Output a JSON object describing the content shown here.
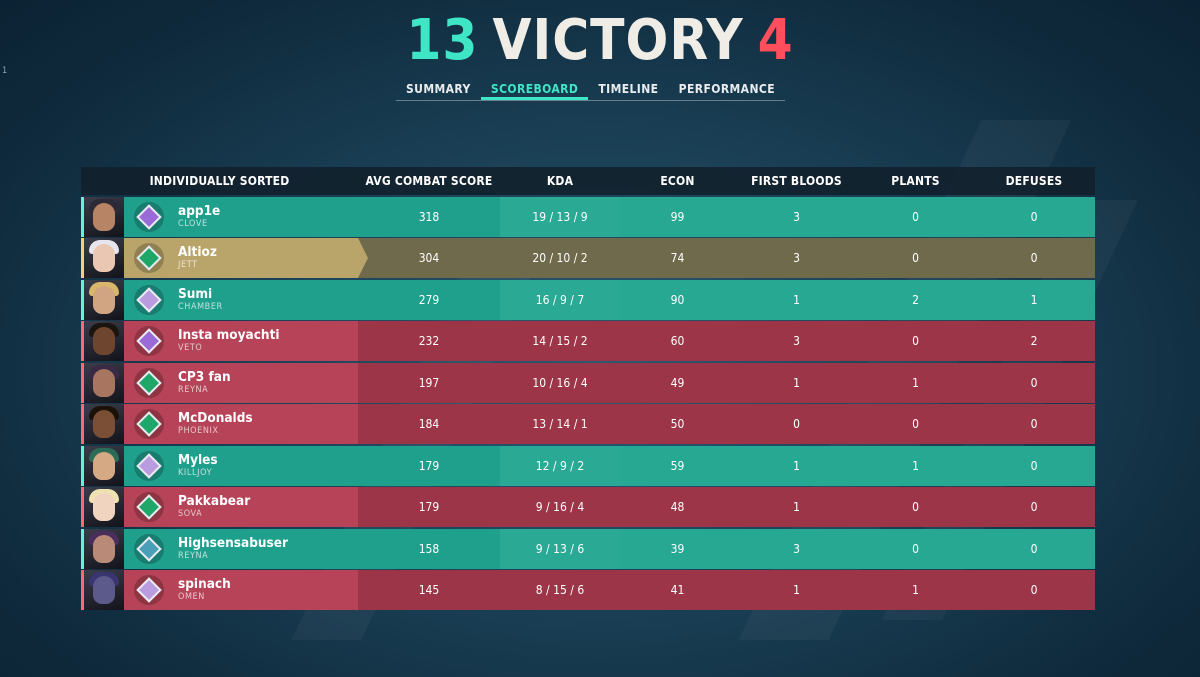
{
  "header": {
    "team_score": "13",
    "result": "VICTORY",
    "enemy_score": "4"
  },
  "corner_mark": "1",
  "tabs": [
    {
      "label": "SUMMARY",
      "active": false
    },
    {
      "label": "SCOREBOARD",
      "active": true
    },
    {
      "label": "TIMELINE",
      "active": false
    },
    {
      "label": "PERFORMANCE",
      "active": false
    }
  ],
  "table": {
    "columns": [
      "INDIVIDUALLY SORTED",
      "AVG COMBAT SCORE",
      "KDA",
      "ECON",
      "FIRST BLOODS",
      "PLANTS",
      "DEFUSES"
    ],
    "rows": [
      {
        "name": "app1e",
        "agent": "CLOVE",
        "acs": "318",
        "kda": "19 / 13 / 9",
        "econ": "99",
        "fb": "3",
        "plants": "0",
        "defuses": "0",
        "side": "team",
        "rank_icon": "amethyst-rank-icon"
      },
      {
        "name": "Altioz",
        "agent": "JETT",
        "acs": "304",
        "kda": "20 / 10 / 2",
        "econ": "74",
        "fb": "3",
        "plants": "0",
        "defuses": "0",
        "side": "self",
        "rank_icon": "emerald-rank-icon"
      },
      {
        "name": "Sumi",
        "agent": "CHAMBER",
        "acs": "279",
        "kda": "16 / 9 / 7",
        "econ": "90",
        "fb": "1",
        "plants": "2",
        "defuses": "1",
        "side": "team",
        "rank_icon": "diamond-rank-icon"
      },
      {
        "name": "Insta moyachti",
        "agent": "VETO",
        "acs": "232",
        "kda": "14 / 15 / 2",
        "econ": "60",
        "fb": "3",
        "plants": "0",
        "defuses": "2",
        "side": "enemy",
        "rank_icon": "amethyst-rank-icon"
      },
      {
        "name": "CP3 fan",
        "agent": "REYNA",
        "acs": "197",
        "kda": "10 / 16 / 4",
        "econ": "49",
        "fb": "1",
        "plants": "1",
        "defuses": "0",
        "side": "enemy",
        "rank_icon": "emerald-rank-icon"
      },
      {
        "name": "McDonalds",
        "agent": "PHOENIX",
        "acs": "184",
        "kda": "13 / 14 / 1",
        "econ": "50",
        "fb": "0",
        "plants": "0",
        "defuses": "0",
        "side": "enemy",
        "rank_icon": "emerald-rank-icon"
      },
      {
        "name": "Myles",
        "agent": "KILLJOY",
        "acs": "179",
        "kda": "12 / 9 / 2",
        "econ": "59",
        "fb": "1",
        "plants": "1",
        "defuses": "0",
        "side": "team",
        "rank_icon": "diamond-rank-icon"
      },
      {
        "name": "Pakkabear",
        "agent": "SOVA",
        "acs": "179",
        "kda": "9 / 16 / 4",
        "econ": "48",
        "fb": "1",
        "plants": "0",
        "defuses": "0",
        "side": "enemy",
        "rank_icon": "emerald-rank-icon"
      },
      {
        "name": "Highsensabuser",
        "agent": "REYNA",
        "acs": "158",
        "kda": "9 / 13 / 6",
        "econ": "39",
        "fb": "3",
        "plants": "0",
        "defuses": "0",
        "side": "team",
        "rank_icon": "platinum-rank-icon"
      },
      {
        "name": "spinach",
        "agent": "OMEN",
        "acs": "145",
        "kda": "8 / 15 / 6",
        "econ": "41",
        "fb": "1",
        "plants": "1",
        "defuses": "0",
        "side": "enemy",
        "rank_icon": "diamond-rank-icon"
      }
    ]
  },
  "colors": {
    "team": "#1f9e8c",
    "enemy": "#a93c4d",
    "self": "#b9a46a",
    "team_score": "#3ee6c6",
    "enemy_score": "#ff4f5c"
  }
}
